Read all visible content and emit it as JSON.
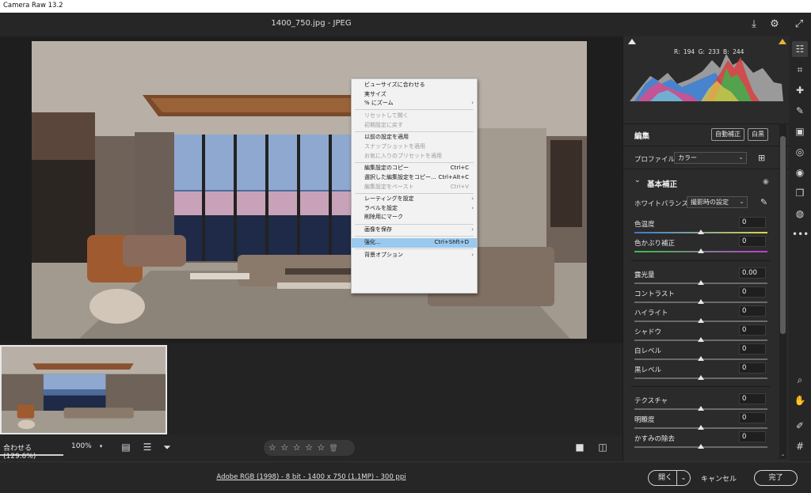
{
  "window": {
    "title": "Camera Raw 13.2"
  },
  "header": {
    "filename": "1400_750.jpg  -  JPEG"
  },
  "context_menu": {
    "items": [
      {
        "label": "ビューサイズに合わせる",
        "shortcut": "",
        "submenu": false,
        "disabled": false
      },
      {
        "label": "実サイズ",
        "shortcut": "",
        "submenu": false,
        "disabled": false
      },
      {
        "label": "% にズーム",
        "shortcut": "",
        "submenu": true,
        "disabled": false
      },
      {
        "sep": true
      },
      {
        "label": "リセットして開く",
        "shortcut": "",
        "submenu": false,
        "disabled": true
      },
      {
        "label": "初期設定に戻す",
        "shortcut": "",
        "submenu": false,
        "disabled": true
      },
      {
        "sep": true
      },
      {
        "label": "以前の設定を適用",
        "shortcut": "",
        "submenu": false,
        "disabled": false
      },
      {
        "label": "スナップショットを適用",
        "shortcut": "",
        "submenu": false,
        "disabled": true
      },
      {
        "label": "お気に入りのプリセットを適用",
        "shortcut": "",
        "submenu": false,
        "disabled": true
      },
      {
        "sep": true
      },
      {
        "label": "編集設定のコピー",
        "shortcut": "Ctrl+C",
        "submenu": false,
        "disabled": false
      },
      {
        "label": "選択した編集設定をコピー...",
        "shortcut": "Ctrl+Alt+C",
        "submenu": false,
        "disabled": false
      },
      {
        "label": "編集設定をペースト",
        "shortcut": "Ctrl+V",
        "submenu": false,
        "disabled": true
      },
      {
        "sep": true
      },
      {
        "label": "レーティングを設定",
        "shortcut": "",
        "submenu": true,
        "disabled": false
      },
      {
        "label": "ラベルを設定",
        "shortcut": "",
        "submenu": true,
        "disabled": false
      },
      {
        "label": "削除用にマーク",
        "shortcut": "",
        "submenu": false,
        "disabled": false
      },
      {
        "sep": true
      },
      {
        "label": "画像を保存",
        "shortcut": "",
        "submenu": true,
        "disabled": false
      },
      {
        "sep": true
      },
      {
        "label": "強化...",
        "shortcut": "Ctrl+Shft+D",
        "submenu": false,
        "disabled": false,
        "highlight": true
      },
      {
        "sep": true
      },
      {
        "label": "背景オプション",
        "shortcut": "",
        "submenu": true,
        "disabled": false
      }
    ]
  },
  "bottombar": {
    "fit_label": "合わせる (129.6%)",
    "zoom_value": "100%"
  },
  "rating": {
    "stars": "☆ ☆ ☆ ☆ ☆"
  },
  "footer": {
    "info": "Adobe RGB (1998) - 8 bit - 1400 x 750 (1.1MP) - 300 ppi",
    "open_label": "開く",
    "cancel_label": "キャンセル",
    "done_label": "完了"
  },
  "panel": {
    "histogram": {
      "r": "R: 194",
      "g": "G: 233",
      "b": "B: 244"
    },
    "edit_title": "編集",
    "auto_label": "自動補正",
    "bw_label": "白黒",
    "profile_label": "プロファイル",
    "profile_value": "カラー",
    "basic_title": "基本補正",
    "wb_label": "ホワイトバランス",
    "wb_value": "撮影時の設定"
  },
  "sliders": {
    "temp": {
      "label": "色温度",
      "value": "0"
    },
    "tint": {
      "label": "色かぶり補正",
      "value": "0"
    },
    "exposure": {
      "label": "露光量",
      "value": "0.00"
    },
    "contrast": {
      "label": "コントラスト",
      "value": "0"
    },
    "highlights": {
      "label": "ハイライト",
      "value": "0"
    },
    "shadows": {
      "label": "シャドウ",
      "value": "0"
    },
    "whites": {
      "label": "白レベル",
      "value": "0"
    },
    "blacks": {
      "label": "黒レベル",
      "value": "0"
    },
    "texture": {
      "label": "テクスチャ",
      "value": "0"
    },
    "clarity": {
      "label": "明瞭度",
      "value": "0"
    },
    "dehaze": {
      "label": "かすみの除去",
      "value": "0"
    }
  },
  "tools": [
    "edit-sliders-icon",
    "crop-icon",
    "healing-icon",
    "brush-icon",
    "gradient-icon",
    "radial-icon",
    "redeye-icon",
    "snapshots-icon",
    "presets-icon",
    "more-icon",
    "zoom-icon",
    "hand-icon",
    "color-sampler-icon",
    "grid-icon"
  ],
  "colors": {
    "accent": "#99c9ee",
    "panel_bg": "#2b2b2b",
    "app_bg": "#1e1e1e"
  }
}
